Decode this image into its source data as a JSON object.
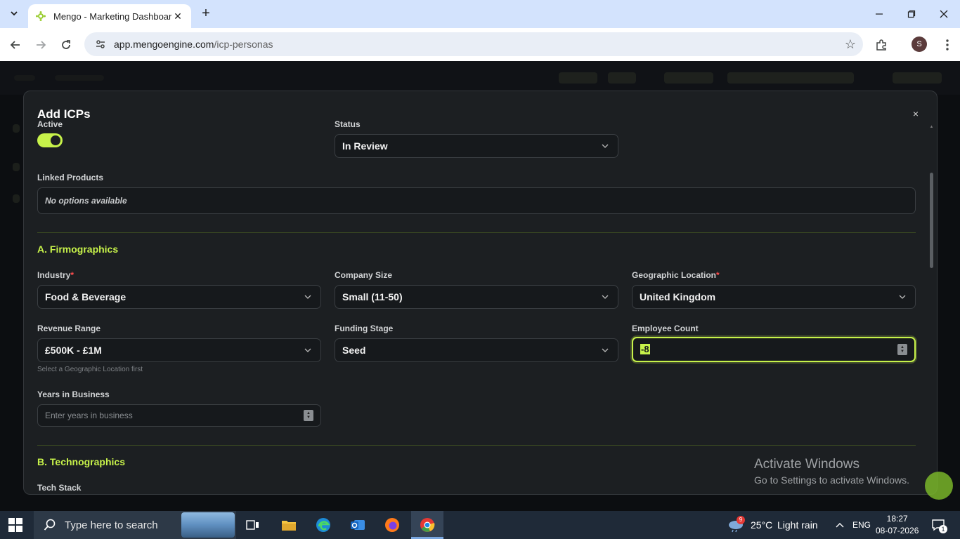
{
  "browser": {
    "tab_title": "Mengo - Marketing Dashboard",
    "url_host": "app.mengoengine.com",
    "url_path": "/icp-personas",
    "profile_initial": "S"
  },
  "modal": {
    "title": "Add ICPs",
    "close": "×",
    "active_label": "Active",
    "active_on": true,
    "status_label": "Status",
    "status_value": "In Review",
    "linked_products_label": "Linked Products",
    "linked_products_value": "No options available",
    "section_a": "A. Firmographics",
    "industry_label": "Industry",
    "industry_value": "Food & Beverage",
    "company_size_label": "Company Size",
    "company_size_value": "Small (11-50)",
    "geo_label": "Geographic Location",
    "geo_value": "United Kingdom",
    "required_mark": "*",
    "revenue_label": "Revenue Range",
    "revenue_value": "£500K - £1M",
    "revenue_helper": "Select a Geographic Location first",
    "funding_label": "Funding Stage",
    "funding_value": "Seed",
    "employee_label": "Employee Count",
    "employee_value": "-8",
    "years_label": "Years in Business",
    "years_placeholder": "Enter years in business",
    "section_b": "B. Technographics",
    "tech_stack_label": "Tech Stack"
  },
  "watermark": {
    "title": "Activate Windows",
    "subtitle": "Go to Settings to activate Windows."
  },
  "taskbar": {
    "search_placeholder": "Type here to search",
    "weather_temp": "25°C",
    "weather_desc": "Light rain",
    "weather_badge": "9",
    "language": "ENG",
    "time": "18:27",
    "date": "08-07-2026",
    "notification_count": "1"
  },
  "colors": {
    "accent": "#c7f24a",
    "modal_bg": "#1c1f22",
    "field_bg": "#16191c"
  }
}
